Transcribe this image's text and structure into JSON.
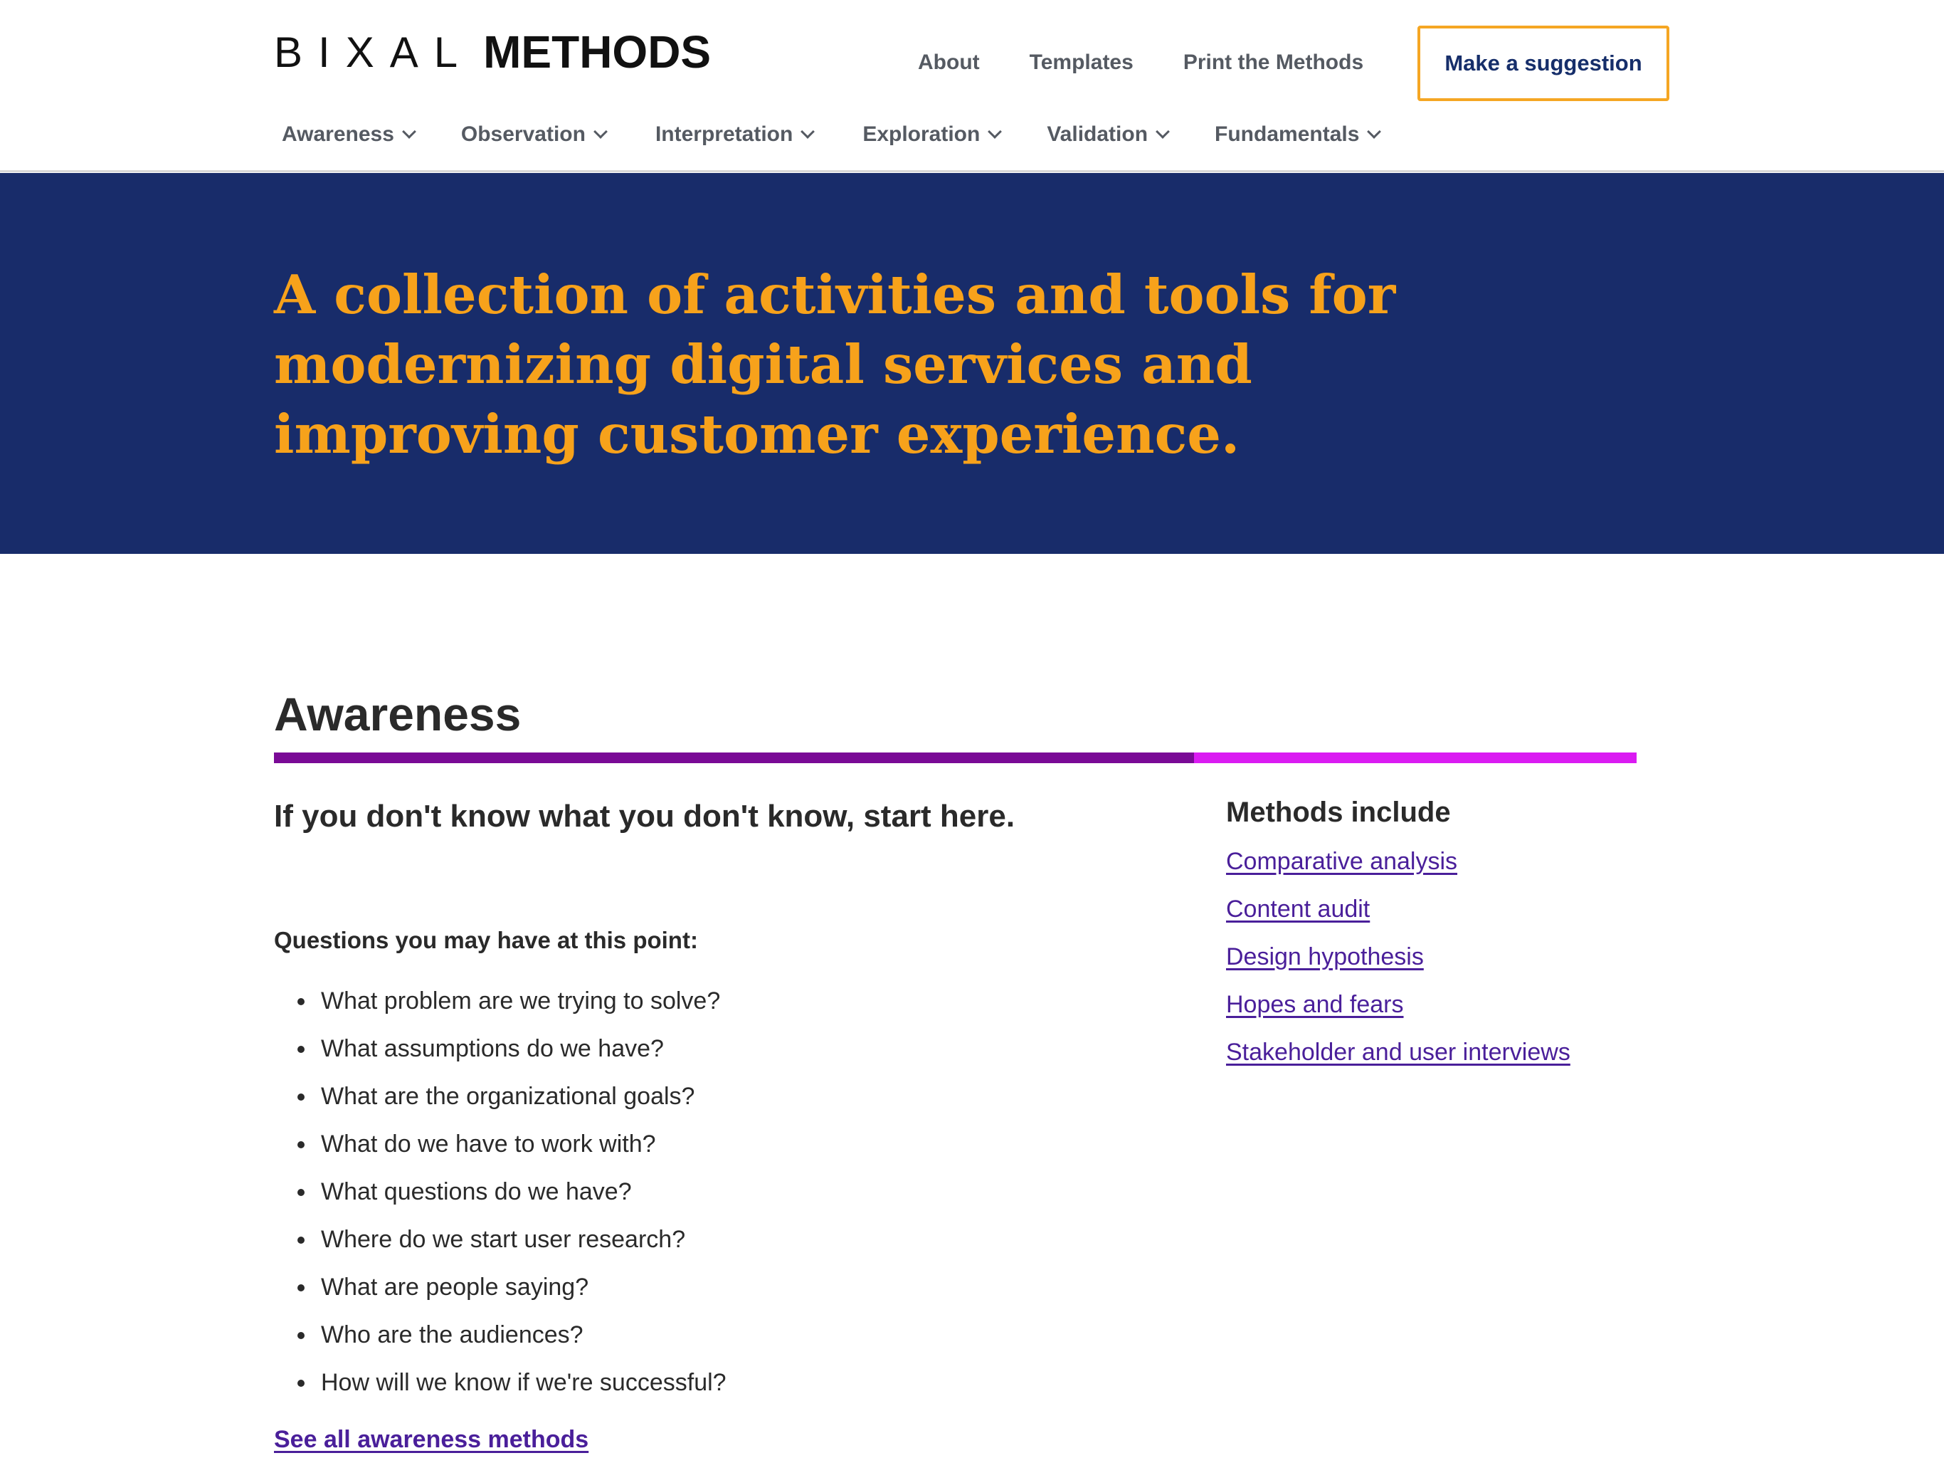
{
  "brand": {
    "company": "BIXAL",
    "product": "METHODS"
  },
  "utility_nav": {
    "items": [
      "About",
      "Templates",
      "Print the Methods"
    ],
    "cta_label": "Make a suggestion"
  },
  "main_nav": {
    "items": [
      "Awareness",
      "Observation",
      "Interpretation",
      "Exploration",
      "Validation",
      "Fundamentals"
    ]
  },
  "hero": {
    "title": "A collection of activities and tools for modernizing digital services and improving customer experience."
  },
  "section": {
    "title": "Awareness",
    "tagline": "If you don't know what you don't know, start here.",
    "questions_heading": "Questions you may have at this point:",
    "questions": [
      "What problem are we trying to solve?",
      "What assumptions do we have?",
      "What are the organizational goals?",
      "What do we have to work with?",
      "What questions do we have?",
      "Where do we start user research?",
      "What are people saying?",
      "Who are the audiences?",
      "How will we know if we're successful?"
    ],
    "see_all_label": "See all awareness methods",
    "methods_heading": "Methods include",
    "methods": [
      "Comparative analysis",
      "Content audit",
      "Design hypothesis",
      "Hopes and fears",
      "Stakeholder and user interviews"
    ]
  },
  "colors": {
    "hero_background": "#182c6a",
    "hero_text": "#f7a21b",
    "cta_border": "#f5a623",
    "divider_primary": "#7a0a96",
    "divider_accent": "#da1bf2",
    "link": "#4a1f9a"
  },
  "icons": {
    "nav_dropdown": "chevron-down-icon",
    "list_bullet": "bullet-icon"
  }
}
